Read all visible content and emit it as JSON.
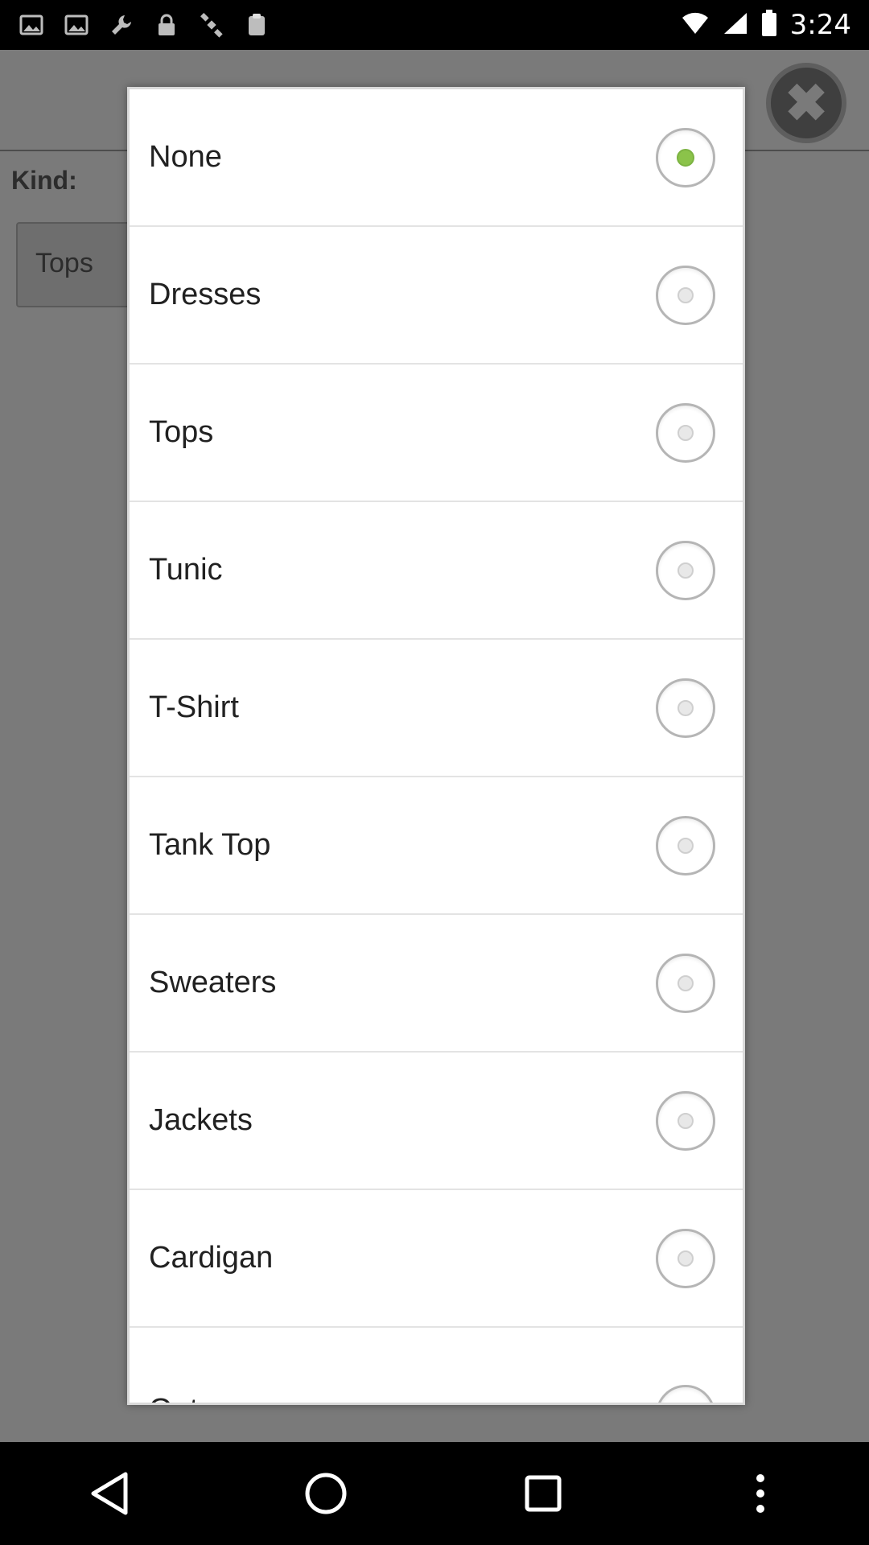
{
  "status_bar": {
    "time": "3:24",
    "icons": [
      "image-icon",
      "image-icon",
      "wrench-icon",
      "lock-icon",
      "satellite-icon",
      "clipboard-icon"
    ]
  },
  "background": {
    "kind_label": "Kind:",
    "kind_value": "Tops"
  },
  "dialog": {
    "options": [
      {
        "label": "None",
        "checked": true
      },
      {
        "label": "Dresses",
        "checked": false
      },
      {
        "label": "Tops",
        "checked": false
      },
      {
        "label": "Tunic",
        "checked": false
      },
      {
        "label": "T-Shirt",
        "checked": false
      },
      {
        "label": "Tank Top",
        "checked": false
      },
      {
        "label": "Sweaters",
        "checked": false
      },
      {
        "label": "Jackets",
        "checked": false
      },
      {
        "label": "Cardigan",
        "checked": false
      },
      {
        "label": "Outerwear",
        "checked": false
      }
    ]
  },
  "colors": {
    "accent": "#8bc34a",
    "overlay": "#7a7a7a"
  }
}
